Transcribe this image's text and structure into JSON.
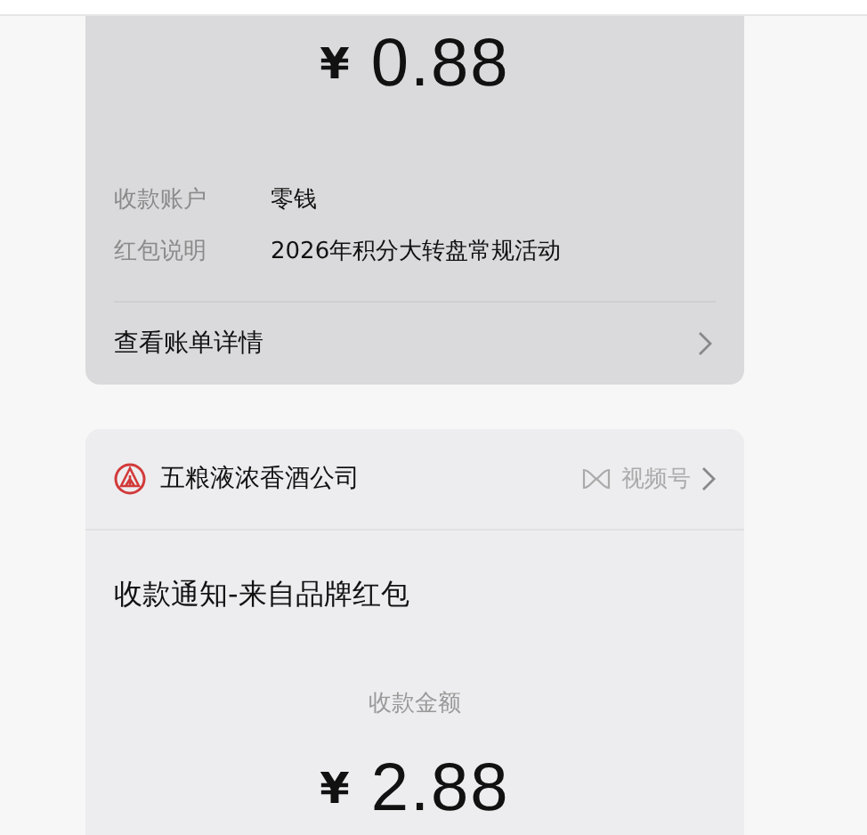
{
  "payment_card": {
    "currency": "¥",
    "amount": "0.88",
    "fields": [
      {
        "label": "收款账户",
        "value": "零钱"
      },
      {
        "label": "红包说明",
        "value": "2026年积分大转盘常规活动"
      }
    ],
    "link": "查看账单详情"
  },
  "notice_card": {
    "sender": "五粮液浓香酒公司",
    "channel": "视频号",
    "title": "收款通知-来自品牌红包",
    "amount_label": "收款金额",
    "currency": "¥",
    "amount": "2.88"
  }
}
